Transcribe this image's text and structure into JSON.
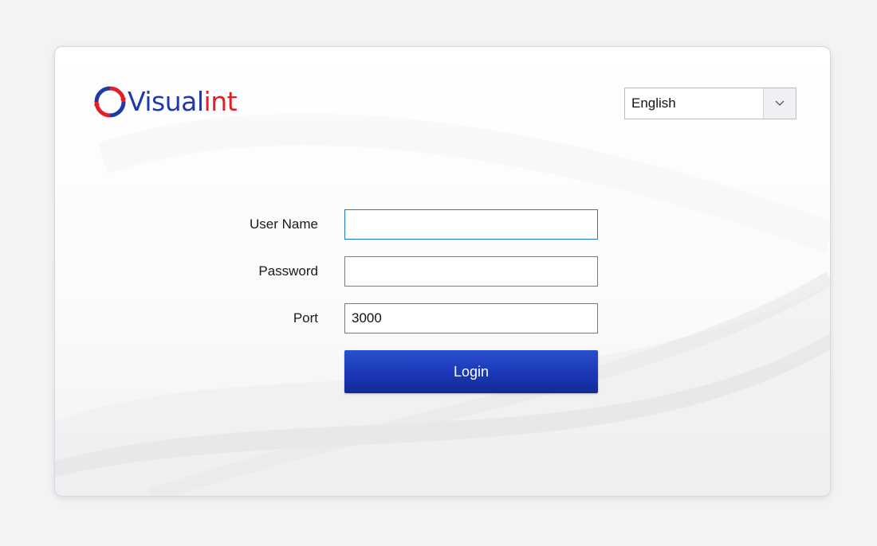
{
  "brand": {
    "name_part1": "Visual",
    "name_part2": "int",
    "color_primary": "#1f3aa8",
    "color_accent": "#e31e25",
    "logo_icon": "ring-arrows-icon"
  },
  "language": {
    "selected": "English",
    "dropdown_icon": "chevron-down-icon"
  },
  "form": {
    "username": {
      "label": "User Name",
      "value": "",
      "placeholder": ""
    },
    "password": {
      "label": "Password",
      "value": "",
      "placeholder": ""
    },
    "port": {
      "label": "Port",
      "value": "3000",
      "placeholder": ""
    },
    "login_label": "Login",
    "button_color": "#1a37b5"
  }
}
